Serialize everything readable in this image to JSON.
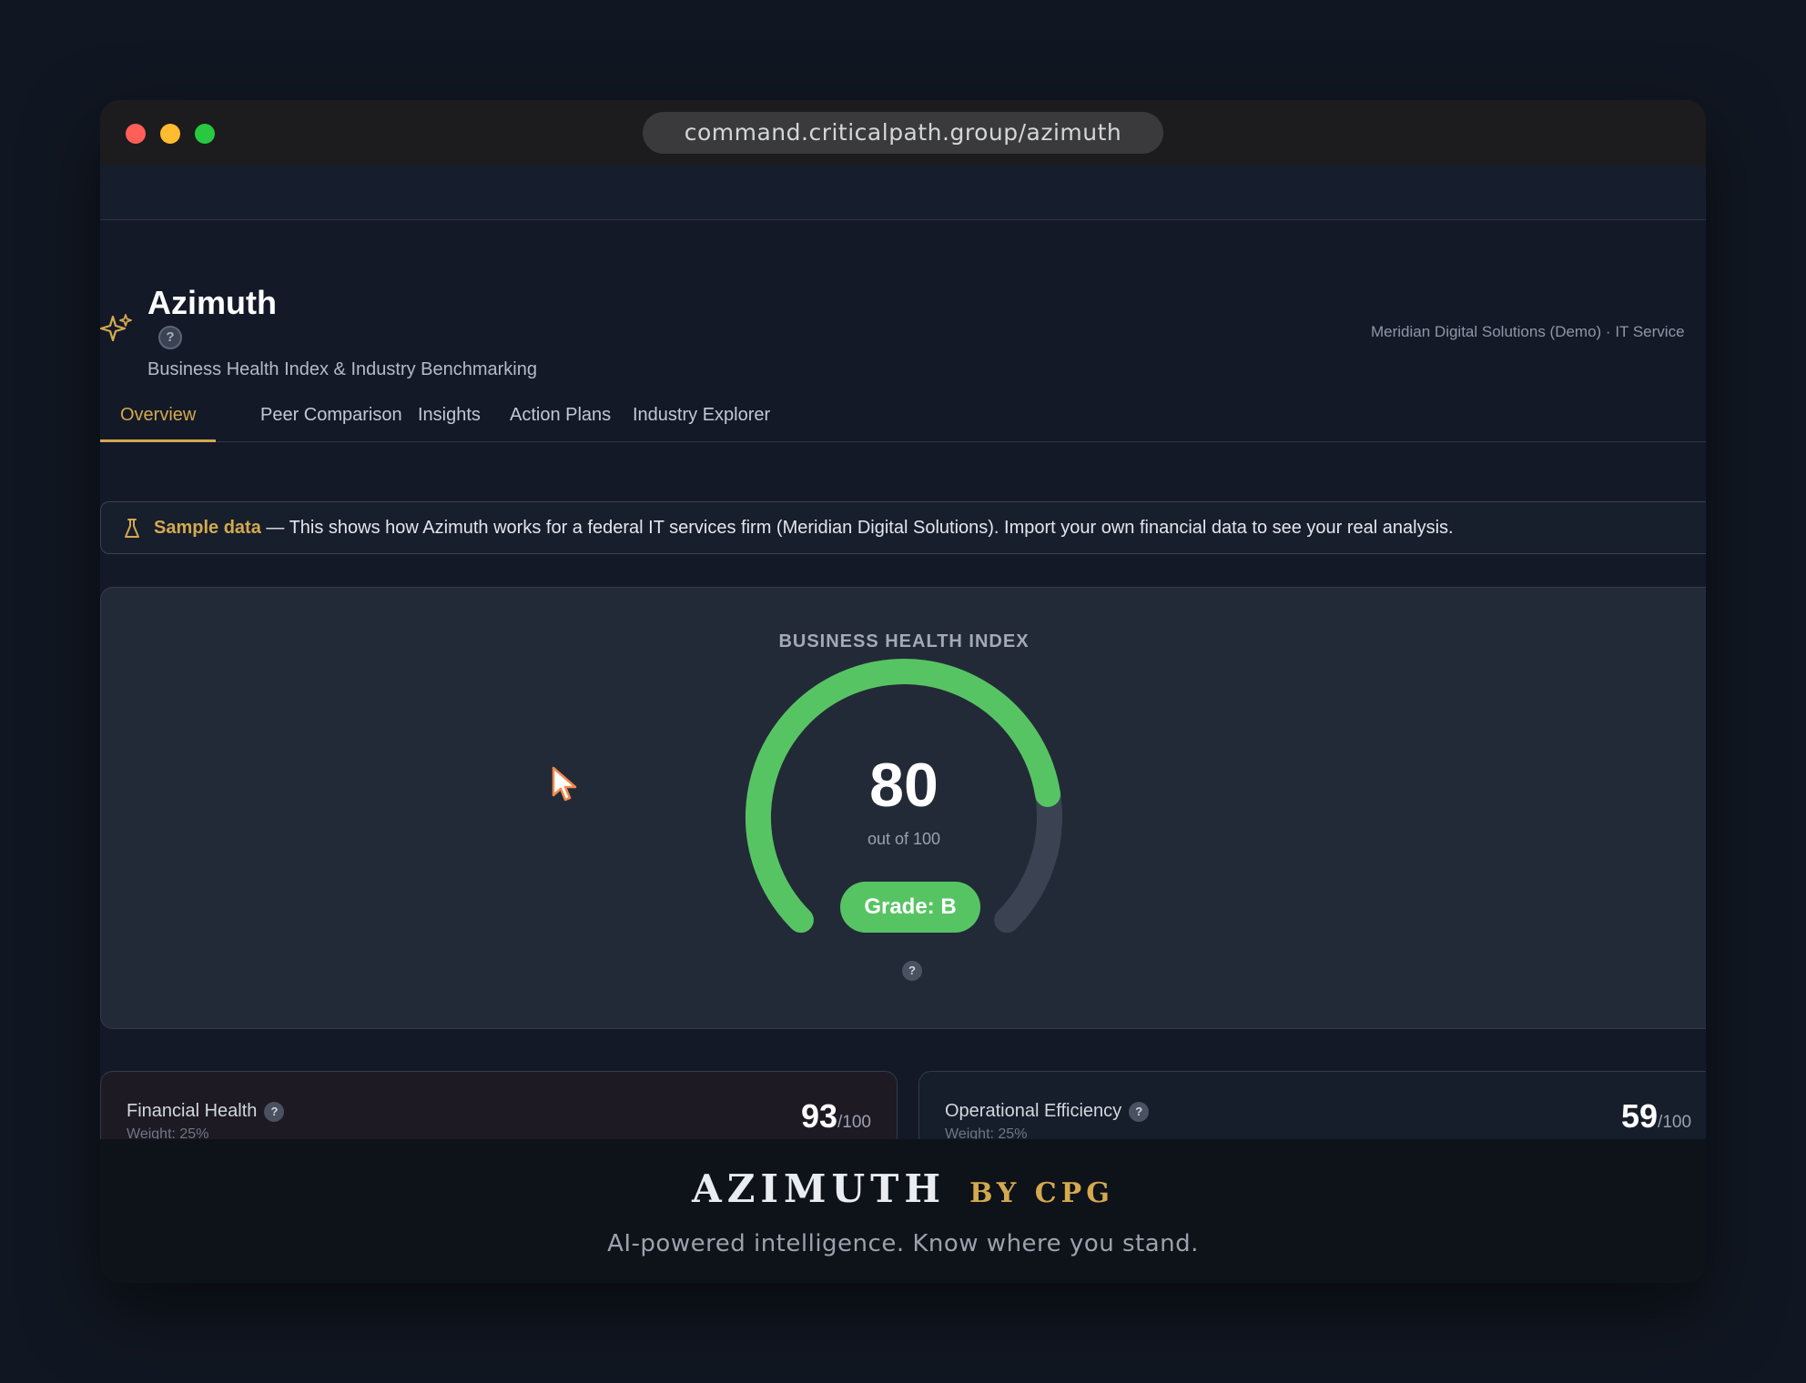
{
  "browser": {
    "url": "command.criticalpath.group/azimuth"
  },
  "header": {
    "title": "Azimuth",
    "help_glyph": "?",
    "subtitle": "Business Health Index & Industry Benchmarking",
    "company": "Meridian Digital Solutions (Demo) · IT Service"
  },
  "tabs": [
    {
      "label": "Overview",
      "active": true
    },
    {
      "label": "Peer Comparison"
    },
    {
      "label": "Insights"
    },
    {
      "label": "Action Plans"
    },
    {
      "label": "Industry Explorer"
    }
  ],
  "banner": {
    "label": "Sample data",
    "text": " — This shows how Azimuth works for a federal IT services firm (Meridian Digital Solutions). Import your own financial data to see your real analysis."
  },
  "health_index": {
    "label": "BUSINESS HEALTH INDEX",
    "score": "80",
    "out_of": "out of 100",
    "grade": "Grade: B",
    "help_glyph": "?",
    "value": 80,
    "max": 100
  },
  "metrics": [
    {
      "name": "Financial Health",
      "help_glyph": "?",
      "weight": "Weight: 25%",
      "score": "93",
      "denom": "/100"
    },
    {
      "name": "Operational Efficiency",
      "help_glyph": "?",
      "weight": "Weight: 25%",
      "score": "59",
      "denom": "/100"
    }
  ],
  "footer": {
    "brand": "AZIMUTH",
    "by": "BY CPG",
    "tagline": "AI-powered intelligence. Know where you stand."
  },
  "colors": {
    "accent_gold": "#d4a94f",
    "gauge_green": "#57c464",
    "gauge_track": "#3b4252",
    "background": "#111722"
  },
  "icons": [
    "sparkle-icon",
    "help-icon",
    "flask-icon",
    "cursor-icon"
  ]
}
